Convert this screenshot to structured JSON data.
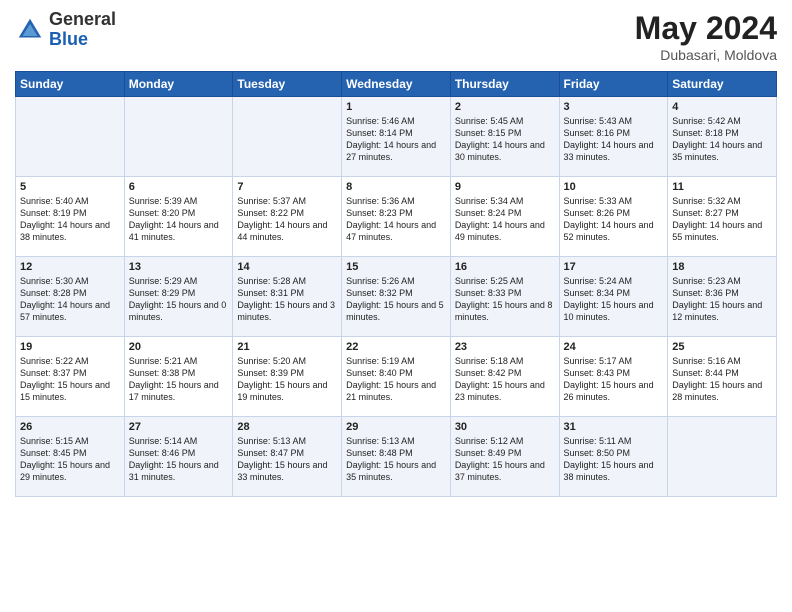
{
  "logo": {
    "general": "General",
    "blue": "Blue"
  },
  "title": "May 2024",
  "subtitle": "Dubasari, Moldova",
  "days_of_week": [
    "Sunday",
    "Monday",
    "Tuesday",
    "Wednesday",
    "Thursday",
    "Friday",
    "Saturday"
  ],
  "weeks": [
    [
      {
        "day": "",
        "sunrise": "",
        "sunset": "",
        "daylight": ""
      },
      {
        "day": "",
        "sunrise": "",
        "sunset": "",
        "daylight": ""
      },
      {
        "day": "",
        "sunrise": "",
        "sunset": "",
        "daylight": ""
      },
      {
        "day": "1",
        "sunrise": "Sunrise: 5:46 AM",
        "sunset": "Sunset: 8:14 PM",
        "daylight": "Daylight: 14 hours and 27 minutes."
      },
      {
        "day": "2",
        "sunrise": "Sunrise: 5:45 AM",
        "sunset": "Sunset: 8:15 PM",
        "daylight": "Daylight: 14 hours and 30 minutes."
      },
      {
        "day": "3",
        "sunrise": "Sunrise: 5:43 AM",
        "sunset": "Sunset: 8:16 PM",
        "daylight": "Daylight: 14 hours and 33 minutes."
      },
      {
        "day": "4",
        "sunrise": "Sunrise: 5:42 AM",
        "sunset": "Sunset: 8:18 PM",
        "daylight": "Daylight: 14 hours and 35 minutes."
      }
    ],
    [
      {
        "day": "5",
        "sunrise": "Sunrise: 5:40 AM",
        "sunset": "Sunset: 8:19 PM",
        "daylight": "Daylight: 14 hours and 38 minutes."
      },
      {
        "day": "6",
        "sunrise": "Sunrise: 5:39 AM",
        "sunset": "Sunset: 8:20 PM",
        "daylight": "Daylight: 14 hours and 41 minutes."
      },
      {
        "day": "7",
        "sunrise": "Sunrise: 5:37 AM",
        "sunset": "Sunset: 8:22 PM",
        "daylight": "Daylight: 14 hours and 44 minutes."
      },
      {
        "day": "8",
        "sunrise": "Sunrise: 5:36 AM",
        "sunset": "Sunset: 8:23 PM",
        "daylight": "Daylight: 14 hours and 47 minutes."
      },
      {
        "day": "9",
        "sunrise": "Sunrise: 5:34 AM",
        "sunset": "Sunset: 8:24 PM",
        "daylight": "Daylight: 14 hours and 49 minutes."
      },
      {
        "day": "10",
        "sunrise": "Sunrise: 5:33 AM",
        "sunset": "Sunset: 8:26 PM",
        "daylight": "Daylight: 14 hours and 52 minutes."
      },
      {
        "day": "11",
        "sunrise": "Sunrise: 5:32 AM",
        "sunset": "Sunset: 8:27 PM",
        "daylight": "Daylight: 14 hours and 55 minutes."
      }
    ],
    [
      {
        "day": "12",
        "sunrise": "Sunrise: 5:30 AM",
        "sunset": "Sunset: 8:28 PM",
        "daylight": "Daylight: 14 hours and 57 minutes."
      },
      {
        "day": "13",
        "sunrise": "Sunrise: 5:29 AM",
        "sunset": "Sunset: 8:29 PM",
        "daylight": "Daylight: 15 hours and 0 minutes."
      },
      {
        "day": "14",
        "sunrise": "Sunrise: 5:28 AM",
        "sunset": "Sunset: 8:31 PM",
        "daylight": "Daylight: 15 hours and 3 minutes."
      },
      {
        "day": "15",
        "sunrise": "Sunrise: 5:26 AM",
        "sunset": "Sunset: 8:32 PM",
        "daylight": "Daylight: 15 hours and 5 minutes."
      },
      {
        "day": "16",
        "sunrise": "Sunrise: 5:25 AM",
        "sunset": "Sunset: 8:33 PM",
        "daylight": "Daylight: 15 hours and 8 minutes."
      },
      {
        "day": "17",
        "sunrise": "Sunrise: 5:24 AM",
        "sunset": "Sunset: 8:34 PM",
        "daylight": "Daylight: 15 hours and 10 minutes."
      },
      {
        "day": "18",
        "sunrise": "Sunrise: 5:23 AM",
        "sunset": "Sunset: 8:36 PM",
        "daylight": "Daylight: 15 hours and 12 minutes."
      }
    ],
    [
      {
        "day": "19",
        "sunrise": "Sunrise: 5:22 AM",
        "sunset": "Sunset: 8:37 PM",
        "daylight": "Daylight: 15 hours and 15 minutes."
      },
      {
        "day": "20",
        "sunrise": "Sunrise: 5:21 AM",
        "sunset": "Sunset: 8:38 PM",
        "daylight": "Daylight: 15 hours and 17 minutes."
      },
      {
        "day": "21",
        "sunrise": "Sunrise: 5:20 AM",
        "sunset": "Sunset: 8:39 PM",
        "daylight": "Daylight: 15 hours and 19 minutes."
      },
      {
        "day": "22",
        "sunrise": "Sunrise: 5:19 AM",
        "sunset": "Sunset: 8:40 PM",
        "daylight": "Daylight: 15 hours and 21 minutes."
      },
      {
        "day": "23",
        "sunrise": "Sunrise: 5:18 AM",
        "sunset": "Sunset: 8:42 PM",
        "daylight": "Daylight: 15 hours and 23 minutes."
      },
      {
        "day": "24",
        "sunrise": "Sunrise: 5:17 AM",
        "sunset": "Sunset: 8:43 PM",
        "daylight": "Daylight: 15 hours and 26 minutes."
      },
      {
        "day": "25",
        "sunrise": "Sunrise: 5:16 AM",
        "sunset": "Sunset: 8:44 PM",
        "daylight": "Daylight: 15 hours and 28 minutes."
      }
    ],
    [
      {
        "day": "26",
        "sunrise": "Sunrise: 5:15 AM",
        "sunset": "Sunset: 8:45 PM",
        "daylight": "Daylight: 15 hours and 29 minutes."
      },
      {
        "day": "27",
        "sunrise": "Sunrise: 5:14 AM",
        "sunset": "Sunset: 8:46 PM",
        "daylight": "Daylight: 15 hours and 31 minutes."
      },
      {
        "day": "28",
        "sunrise": "Sunrise: 5:13 AM",
        "sunset": "Sunset: 8:47 PM",
        "daylight": "Daylight: 15 hours and 33 minutes."
      },
      {
        "day": "29",
        "sunrise": "Sunrise: 5:13 AM",
        "sunset": "Sunset: 8:48 PM",
        "daylight": "Daylight: 15 hours and 35 minutes."
      },
      {
        "day": "30",
        "sunrise": "Sunrise: 5:12 AM",
        "sunset": "Sunset: 8:49 PM",
        "daylight": "Daylight: 15 hours and 37 minutes."
      },
      {
        "day": "31",
        "sunrise": "Sunrise: 5:11 AM",
        "sunset": "Sunset: 8:50 PM",
        "daylight": "Daylight: 15 hours and 38 minutes."
      },
      {
        "day": "",
        "sunrise": "",
        "sunset": "",
        "daylight": ""
      }
    ]
  ]
}
